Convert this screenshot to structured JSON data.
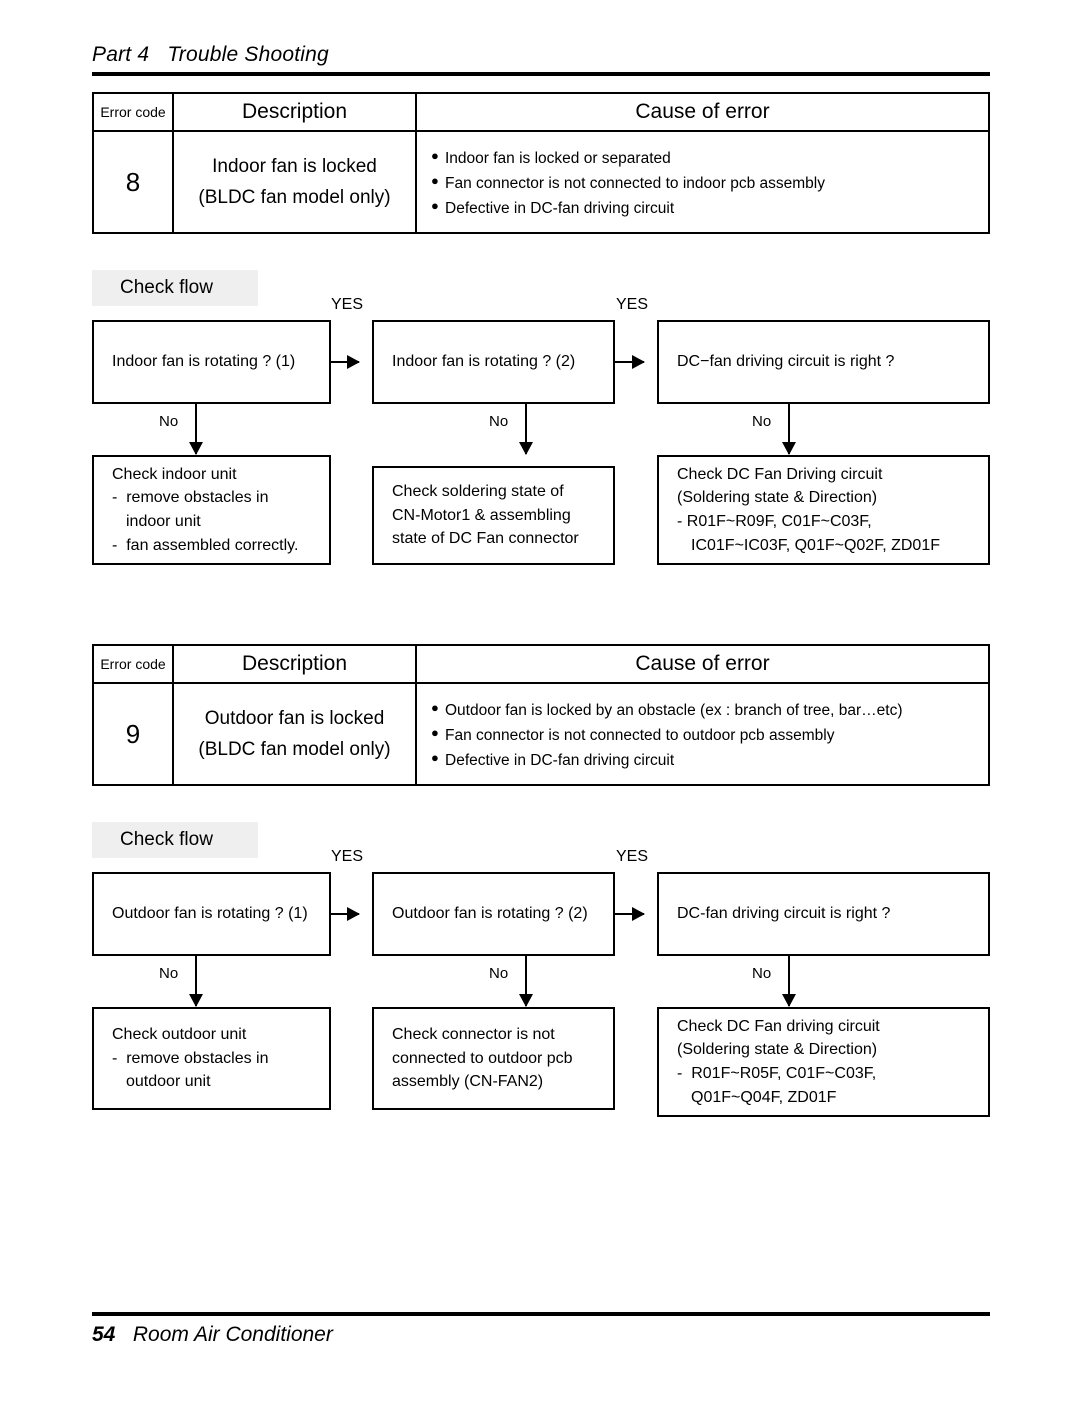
{
  "header": {
    "part_label": "Part 4",
    "title": "Trouble Shooting",
    "full": "Part 4   Trouble Shooting"
  },
  "footer": {
    "page_number": "54",
    "book_title": "Room Air Conditioner"
  },
  "tables": [
    {
      "columns": {
        "error_code": "Error code",
        "description": "Description",
        "cause": "Cause of error"
      },
      "row": {
        "code": "8",
        "description_lines": [
          "Indoor fan is locked",
          "(BLDC fan model only)"
        ],
        "causes": [
          "Indoor fan is locked or separated",
          "Fan connector is not connected to indoor pcb assembly",
          "Defective in DC-fan driving circuit"
        ]
      }
    },
    {
      "columns": {
        "error_code": "Error code",
        "description": "Description",
        "cause": "Cause of error"
      },
      "row": {
        "code": "9",
        "description_lines": [
          "Outdoor fan is locked",
          "(BLDC fan model only)"
        ],
        "causes": [
          "Outdoor fan is locked by an obstacle (ex : branch of tree, bar…etc)",
          "Fan connector is not connected to outdoor pcb assembly",
          "Defective in DC-fan driving circuit"
        ]
      }
    }
  ],
  "flows": [
    {
      "label": "Check flow",
      "yes_labels": [
        "YES",
        "YES"
      ],
      "no_labels": [
        "No",
        "No",
        "No"
      ],
      "top_boxes": [
        "Indoor fan is rotating ? (1)",
        "Indoor fan is rotating ? (2)",
        "DC−fan driving circuit is right ?"
      ],
      "bottom_boxes": [
        {
          "lines": [
            {
              "text": "Check indoor unit",
              "indent": 0
            },
            {
              "text": "-  remove obstacles in",
              "indent": 0
            },
            {
              "text": "indoor unit",
              "indent": 1
            },
            {
              "text": "-  fan assembled correctly.",
              "indent": 0
            }
          ]
        },
        {
          "lines": [
            {
              "text": "Check soldering state of",
              "indent": 0
            },
            {
              "text": "CN-Motor1 & assembling",
              "indent": 0
            },
            {
              "text": "state of DC Fan connector",
              "indent": 0
            }
          ]
        },
        {
          "lines": [
            {
              "text": "Check DC Fan Driving circuit",
              "indent": 0
            },
            {
              "text": "(Soldering state & Direction)",
              "indent": 0
            },
            {
              "text": "- R01F~R09F, C01F~C03F,",
              "indent": 0
            },
            {
              "text": "IC01F~IC03F, Q01F~Q02F, ZD01F",
              "indent": 1
            }
          ]
        }
      ]
    },
    {
      "label": "Check flow",
      "yes_labels": [
        "YES",
        "YES"
      ],
      "no_labels": [
        "No",
        "No",
        "No"
      ],
      "top_boxes": [
        "Outdoor fan is rotating ? (1)",
        "Outdoor fan is rotating ? (2)",
        "DC-fan driving circuit is right ?"
      ],
      "bottom_boxes": [
        {
          "lines": [
            {
              "text": "Check outdoor unit",
              "indent": 0
            },
            {
              "text": "-  remove obstacles in",
              "indent": 0
            },
            {
              "text": "outdoor unit",
              "indent": 1
            }
          ]
        },
        {
          "lines": [
            {
              "text": "Check connector is not",
              "indent": 0
            },
            {
              "text": "connected to outdoor pcb",
              "indent": 0
            },
            {
              "text": "assembly (CN-FAN2)",
              "indent": 0
            }
          ]
        },
        {
          "lines": [
            {
              "text": "Check DC Fan driving circuit",
              "indent": 0
            },
            {
              "text": "(Soldering state & Direction)",
              "indent": 0
            },
            {
              "text": "-  R01F~R05F, C01F~C03F,",
              "indent": 0
            },
            {
              "text": "Q01F~Q04F, ZD01F",
              "indent": 1
            }
          ]
        }
      ]
    }
  ],
  "colors": {
    "ink": "#000000",
    "page": "#ffffff",
    "label_background": "#efefef"
  }
}
